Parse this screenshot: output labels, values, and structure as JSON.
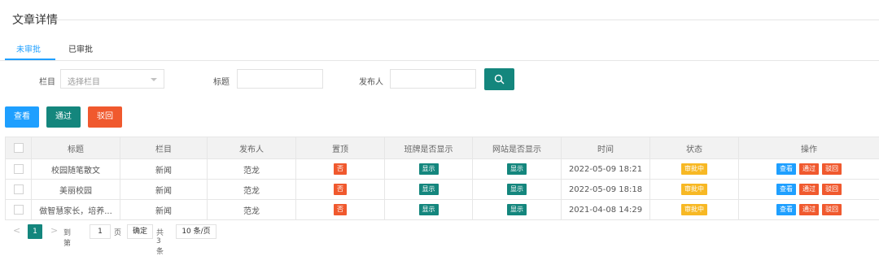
{
  "page": {
    "title": "文章详情"
  },
  "tabs": [
    {
      "label": "未审批",
      "active": true
    },
    {
      "label": "已审批",
      "active": false
    }
  ],
  "filters": {
    "column_label": "栏目",
    "column_placeholder": "选择栏目",
    "title_label": "标题",
    "title_value": "",
    "publisher_label": "发布人",
    "publisher_value": "",
    "search_icon": "search-icon"
  },
  "actions": {
    "view": "查看",
    "approve": "通过",
    "reject": "驳回"
  },
  "table": {
    "headers": [
      "",
      "标题",
      "栏目",
      "发布人",
      "置顶",
      "班牌是否显示",
      "网站是否显示",
      "时间",
      "状态",
      "操作"
    ],
    "rows": [
      {
        "title": "校园随笔散文",
        "column": "新闻",
        "publisher": "范龙",
        "pinned": "否",
        "board_display": "显示",
        "site_display": "显示",
        "time": "2022-05-09 18:21",
        "status": "审批中",
        "ops": [
          "查看",
          "通过",
          "驳回"
        ]
      },
      {
        "title": "美丽校园",
        "column": "新闻",
        "publisher": "范龙",
        "pinned": "否",
        "board_display": "显示",
        "site_display": "显示",
        "time": "2022-05-09 18:18",
        "status": "审批中",
        "ops": [
          "查看",
          "通过",
          "驳回"
        ]
      },
      {
        "title": "做智慧家长，培养...",
        "column": "新闻",
        "publisher": "范龙",
        "pinned": "否",
        "board_display": "显示",
        "site_display": "显示",
        "time": "2021-04-08 14:29",
        "status": "审批中",
        "ops": [
          "查看",
          "通过",
          "驳回"
        ]
      }
    ]
  },
  "pagination": {
    "prev": "<",
    "current_page": "1",
    "next": ">",
    "goto_label": "到第",
    "goto_value": "1",
    "page_unit": "页",
    "confirm": "确定",
    "total": "共 3 条",
    "page_size": "10 条/页"
  },
  "colors": {
    "primary": "#14867d",
    "accent_blue": "#1e9fff",
    "danger": "#f0592e",
    "warning": "#f7b824"
  }
}
